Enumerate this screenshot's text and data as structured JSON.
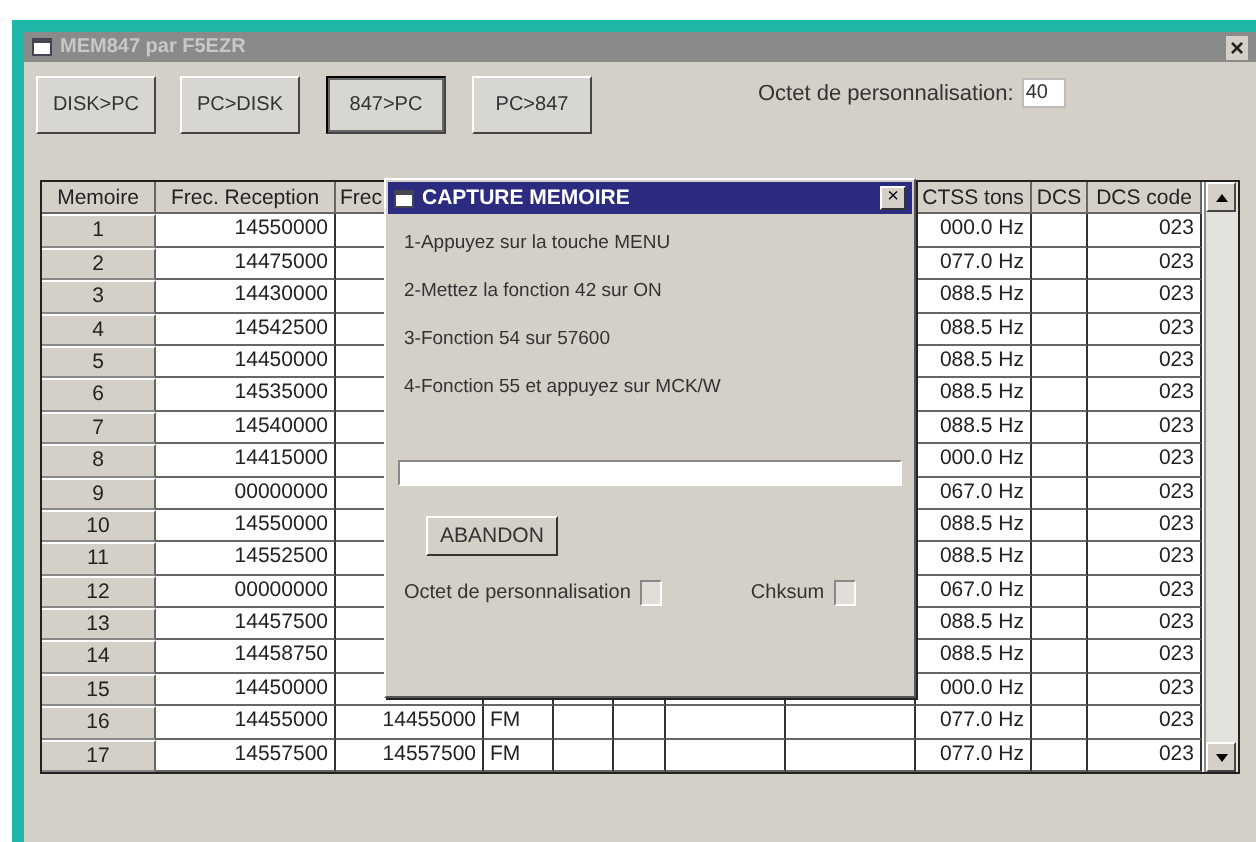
{
  "window": {
    "title": "MEM847 par F5EZR",
    "close": "×"
  },
  "toolbar": {
    "buttons": [
      {
        "label": "DISK>PC",
        "selected": false
      },
      {
        "label": "PC>DISK",
        "selected": false
      },
      {
        "label": "847>PC",
        "selected": true
      },
      {
        "label": "PC>847",
        "selected": false
      }
    ],
    "octet_label": "Octet de personnalisation:",
    "octet_value": "40"
  },
  "table": {
    "columns": [
      "Memoire",
      "Frec. Reception",
      "Frec",
      "CTSS tons",
      "DCS",
      "DCS code"
    ],
    "rows": [
      {
        "memoire": "1",
        "rx": "14550000",
        "ctss": "000.0 Hz",
        "dcs_code": "023"
      },
      {
        "memoire": "2",
        "rx": "14475000",
        "ctss": "077.0 Hz",
        "dcs_code": "023"
      },
      {
        "memoire": "3",
        "rx": "14430000",
        "ctss": "088.5 Hz",
        "dcs_code": "023"
      },
      {
        "memoire": "4",
        "rx": "14542500",
        "ctss": "088.5 Hz",
        "dcs_code": "023"
      },
      {
        "memoire": "5",
        "rx": "14450000",
        "ctss": "088.5 Hz",
        "dcs_code": "023"
      },
      {
        "memoire": "6",
        "rx": "14535000",
        "ctss": "088.5 Hz",
        "dcs_code": "023"
      },
      {
        "memoire": "7",
        "rx": "14540000",
        "ctss": "088.5 Hz",
        "dcs_code": "023"
      },
      {
        "memoire": "8",
        "rx": "14415000",
        "ctss": "000.0 Hz",
        "dcs_code": "023"
      },
      {
        "memoire": "9",
        "rx": "00000000",
        "ctss": "067.0 Hz",
        "dcs_code": "023"
      },
      {
        "memoire": "10",
        "rx": "14550000",
        "ctss": "088.5 Hz",
        "dcs_code": "023"
      },
      {
        "memoire": "11",
        "rx": "14552500",
        "ctss": "088.5 Hz",
        "dcs_code": "023"
      },
      {
        "memoire": "12",
        "rx": "00000000",
        "ctss": "067.0 Hz",
        "dcs_code": "023"
      },
      {
        "memoire": "13",
        "rx": "14457500",
        "ctss": "088.5 Hz",
        "dcs_code": "023"
      },
      {
        "memoire": "14",
        "rx": "14458750",
        "ctss": "088.5 Hz",
        "dcs_code": "023"
      },
      {
        "memoire": "15",
        "rx": "14450000",
        "ctss": "000.0 Hz",
        "dcs_code": "023"
      },
      {
        "memoire": "16",
        "rx": "14455000",
        "tx": "14455000",
        "mode": "FM",
        "ctss": "077.0 Hz",
        "dcs_code": "023"
      },
      {
        "memoire": "17",
        "rx": "14557500",
        "tx": "14557500",
        "mode": "FM",
        "ctss": "077.0 Hz",
        "dcs_code": "023"
      }
    ]
  },
  "dialog": {
    "title": "CAPTURE MEMOIRE",
    "close": "×",
    "steps": [
      "1-Appuyez sur la touche MENU",
      "2-Mettez la fonction 42 sur ON",
      "3-Fonction 54 sur 57600",
      "4-Fonction 55 et appuyez sur MCK/W"
    ],
    "progress": {
      "level": 0
    },
    "button": "ABANDON",
    "checkboxes": [
      {
        "label": "Octet de personnalisation",
        "checked": false
      },
      {
        "label": "Chksum",
        "checked": false
      }
    ]
  }
}
